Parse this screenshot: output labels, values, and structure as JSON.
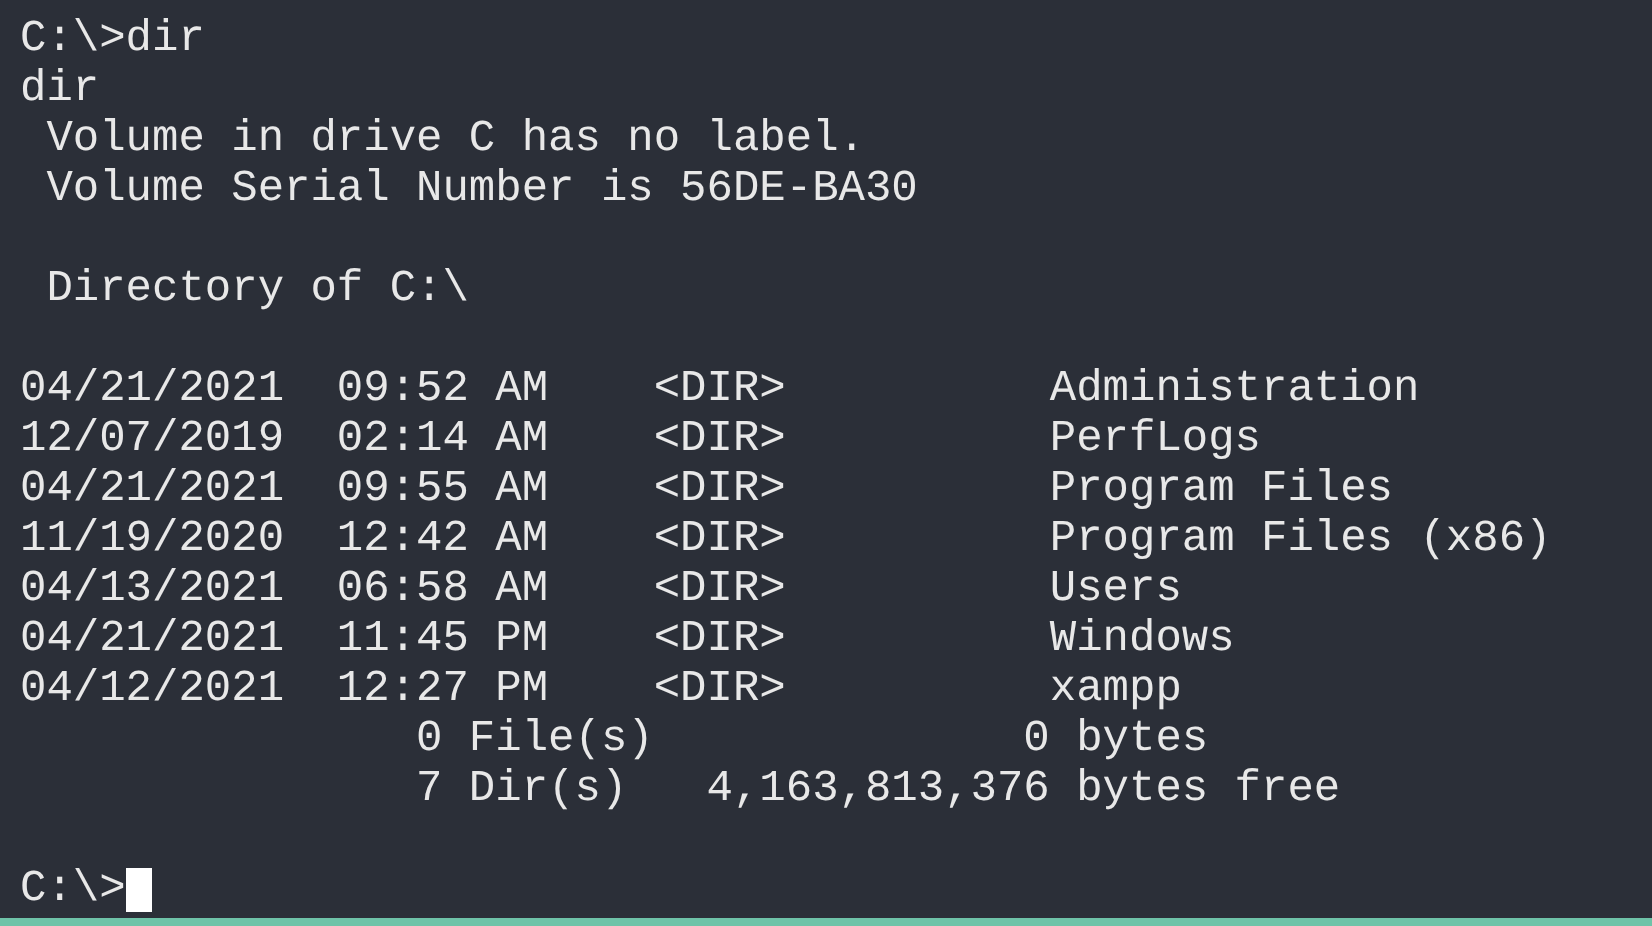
{
  "terminal": {
    "lines": [
      {
        "kind": "text",
        "text": "C:\\>dir"
      },
      {
        "kind": "text",
        "text": "dir"
      },
      {
        "kind": "text",
        "text": " Volume in drive C has no label."
      },
      {
        "kind": "text",
        "text": " Volume Serial Number is 56DE-BA30"
      },
      {
        "kind": "blank"
      },
      {
        "kind": "text",
        "text": " Directory of C:\\"
      },
      {
        "kind": "blank"
      },
      {
        "kind": "text",
        "text": "04/21/2021  09:52 AM    <DIR>          Administration"
      },
      {
        "kind": "text",
        "text": "12/07/2019  02:14 AM    <DIR>          PerfLogs"
      },
      {
        "kind": "text",
        "text": "04/21/2021  09:55 AM    <DIR>          Program Files"
      },
      {
        "kind": "text",
        "text": "11/19/2020  12:42 AM    <DIR>          Program Files (x86)"
      },
      {
        "kind": "text",
        "text": "04/13/2021  06:58 AM    <DIR>          Users"
      },
      {
        "kind": "text",
        "text": "04/21/2021  11:45 PM    <DIR>          Windows"
      },
      {
        "kind": "text",
        "text": "04/12/2021  12:27 PM    <DIR>          xampp"
      },
      {
        "kind": "text",
        "text": "               0 File(s)              0 bytes"
      },
      {
        "kind": "text",
        "text": "               7 Dir(s)   4,163,813,376 bytes free"
      },
      {
        "kind": "blank"
      },
      {
        "kind": "prompt",
        "text": "C:\\>",
        "cursor": true
      }
    ]
  }
}
